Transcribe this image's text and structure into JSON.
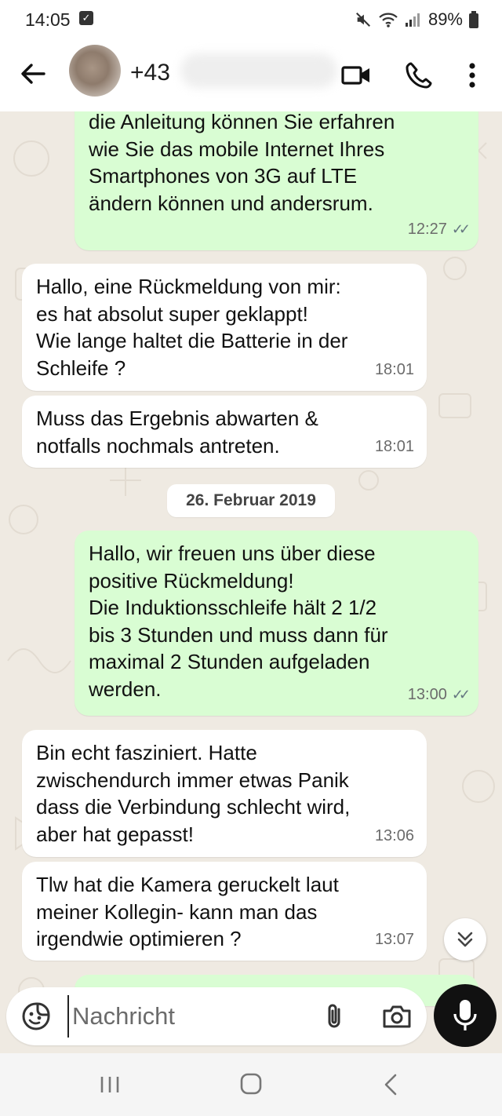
{
  "status": {
    "time": "14:05",
    "battery": "89%"
  },
  "header": {
    "contact_name": "+43"
  },
  "messages": [
    {
      "direction": "out",
      "text": "die Anleitung können Sie erfahren\nwie Sie das mobile Internet Ihres\nSmartphones von 3G auf LTE\nändern können und andersrum.",
      "time": "12:27",
      "status": "read"
    },
    {
      "direction": "in",
      "text": "Hallo, eine Rückmeldung von mir:\nes hat absolut super geklappt!\nWie lange haltet die Batterie in der\nSchleife ?",
      "time": "18:01"
    },
    {
      "direction": "in",
      "text": "Muss das Ergebnis abwarten &\nnotfalls nochmals antreten.",
      "time": "18:01"
    },
    {
      "direction": "out",
      "text": "Hallo, wir freuen uns über diese\npositive Rückmeldung!\nDie Induktionsschleife hält 2 1/2\nbis 3 Stunden und muss dann für\nmaximal 2 Stunden aufgeladen\nwerden.",
      "time": "13:00",
      "status": "read"
    },
    {
      "direction": "in",
      "text": "Bin echt fasziniert. Hatte\nzwischendurch immer etwas Panik\ndass die Verbindung schlecht wird,\naber hat gepasst!",
      "time": "13:06"
    },
    {
      "direction": "in",
      "text": "Tlw hat die Kamera geruckelt laut\nmeiner Kollegin- kann man das\nirgendwie optimieren ?",
      "time": "13:07"
    }
  ],
  "date_separator": "26. Februar 2019",
  "composer": {
    "placeholder": "Nachricht"
  },
  "colors": {
    "outgoing_bubble": "#d9fdd3",
    "incoming_bubble": "#ffffff",
    "chat_background": "#efeae2",
    "mic_button": "#111111"
  },
  "icons": {
    "back": "arrow-left-icon",
    "video": "video-camera-icon",
    "call": "phone-icon",
    "menu": "more-vertical-icon",
    "emoji": "emoji-sticker-icon",
    "attach": "paperclip-icon",
    "camera": "camera-icon",
    "mic": "microphone-icon",
    "scroll": "double-chevron-down-icon"
  }
}
